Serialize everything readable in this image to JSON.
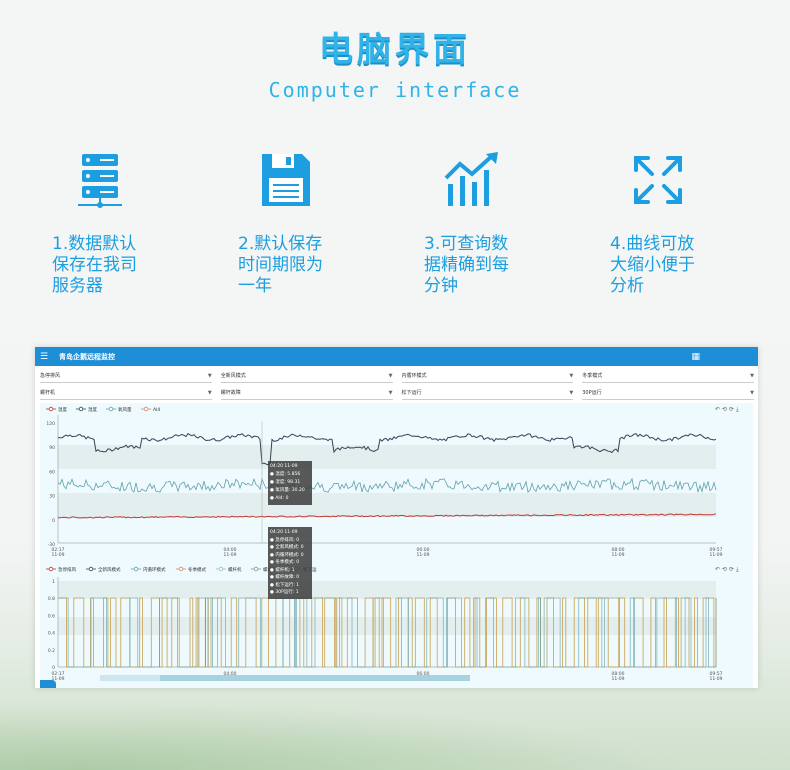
{
  "header": {
    "title": "电脑界面",
    "subtitle": "Computer interface"
  },
  "features": [
    {
      "icon": "server-icon",
      "text": "1.数据默认\n保存在我司\n服务器"
    },
    {
      "icon": "floppy-disk-icon",
      "text": "2.默认保存\n时间期限为\n一年"
    },
    {
      "icon": "bar-chart-icon",
      "text": "3.可查询数\n据精确到每\n分钟"
    },
    {
      "icon": "expand-arrows-icon",
      "text": "4.曲线可放\n大缩小便于\n分析"
    }
  ],
  "app": {
    "title": "青岛企鹅远程监控",
    "selects_row1": [
      "急停排风",
      "全新风模式",
      "内循环模式",
      "冬季模式"
    ],
    "selects_row2": [
      "螺杆机",
      "螺杆故障",
      "松下运行",
      "30P运行"
    ],
    "chart1_legend": [
      "温度",
      "湿度",
      "氧风量",
      "AI4"
    ],
    "chart1_yticks": [
      "120",
      "90",
      "60",
      "30",
      "0",
      "-30"
    ],
    "chart1_xticks": [
      [
        "02:17",
        "11-09"
      ],
      [
        "04:00",
        "11-09"
      ],
      [
        "06:00",
        "11-09"
      ],
      [
        "08:00",
        "11-09"
      ],
      [
        "09:57",
        "11-09"
      ]
    ],
    "tooltip1": {
      "time": "04:20 11-09",
      "rows": [
        "温度: 5.856",
        "湿度: 98.31",
        "氧风量: 30.20",
        "AI4: 0"
      ]
    },
    "chart2_legend": [
      "急停排风",
      "全新风模式",
      "内循环模式",
      "冬季模式",
      "螺杆机",
      "螺杆故障",
      "松下运"
    ],
    "chart2_yticks": [
      "1",
      "0.8",
      "0.6",
      "0.4",
      "0.2",
      "0"
    ],
    "chart2_xticks": [
      [
        "02:17",
        "11-09"
      ],
      [
        "04:00",
        "11-09"
      ],
      [
        "06:00",
        "11-09"
      ],
      [
        "08:00",
        "11-09"
      ],
      [
        "09:57",
        "11-09"
      ]
    ],
    "tooltip2": {
      "time": "04:20 11-09",
      "rows": [
        "急停排风: 0",
        "全新风模式: 0",
        "内循环模式: 0",
        "冬季模式: 0",
        "螺杆机: 1",
        "螺杆故障: 0",
        "松下运行: 1",
        "30P运行: 1"
      ]
    },
    "colors": {
      "header": "#1e8fd6",
      "temp": "#c23531",
      "humidity": "#2f4554",
      "airflow": "#61a0a8",
      "ai4": "#d48265",
      "mode_gold": "#c8a050"
    }
  }
}
